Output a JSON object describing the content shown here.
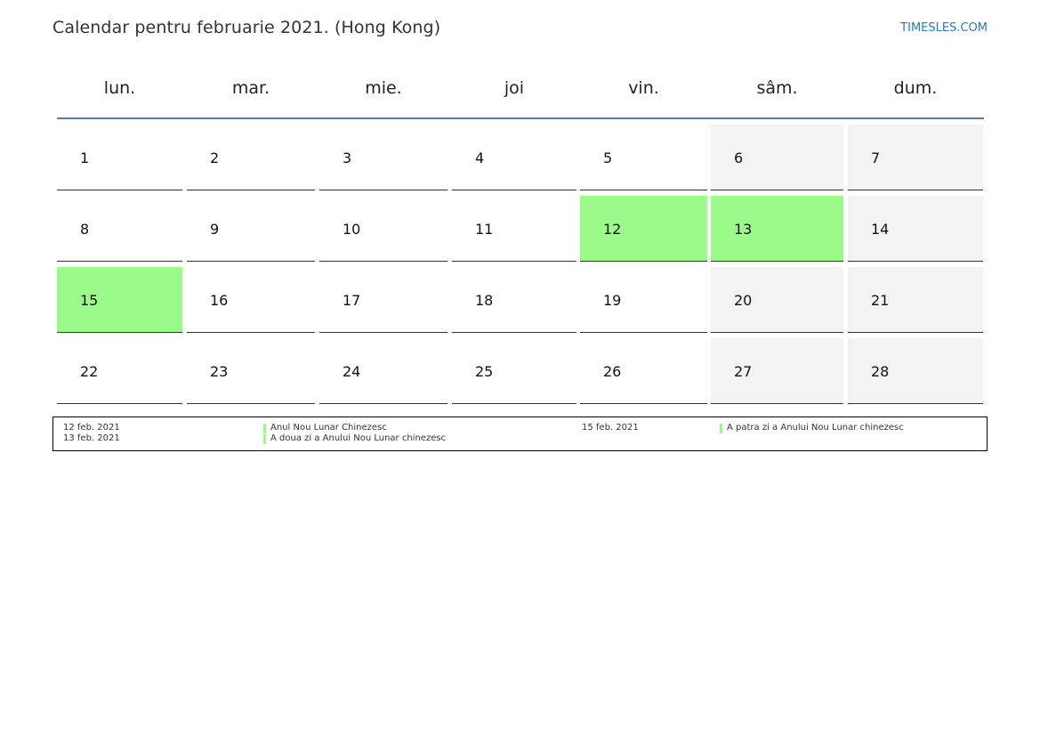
{
  "header": {
    "title": "Calendar pentru februarie 2021. (Hong Kong)",
    "brand": "TIMESLES.COM"
  },
  "weekdays": [
    "lun.",
    "mar.",
    "mie.",
    "joi",
    "vin.",
    "sâm.",
    "dum."
  ],
  "weeks": [
    [
      "1",
      "2",
      "3",
      "4",
      "5",
      "6",
      "7"
    ],
    [
      "8",
      "9",
      "10",
      "11",
      "12",
      "13",
      "14"
    ],
    [
      "15",
      "16",
      "17",
      "18",
      "19",
      "20",
      "21"
    ],
    [
      "22",
      "23",
      "24",
      "25",
      "26",
      "27",
      "28"
    ]
  ],
  "colors": {
    "holiday": "#9afa8a",
    "weekend": "#f3f3f3",
    "header_rule": "#5a7ba0",
    "brand": "#2a7ab8"
  },
  "holidays": [
    {
      "date": "12 feb. 2021",
      "name": "Anul Nou Lunar Chinezesc"
    },
    {
      "date": "13 feb. 2021",
      "name": "A doua zi a Anului Nou Lunar chinezesc"
    },
    {
      "date": "15 feb. 2021",
      "name": "A patra zi a Anului Nou Lunar chinezesc"
    }
  ]
}
